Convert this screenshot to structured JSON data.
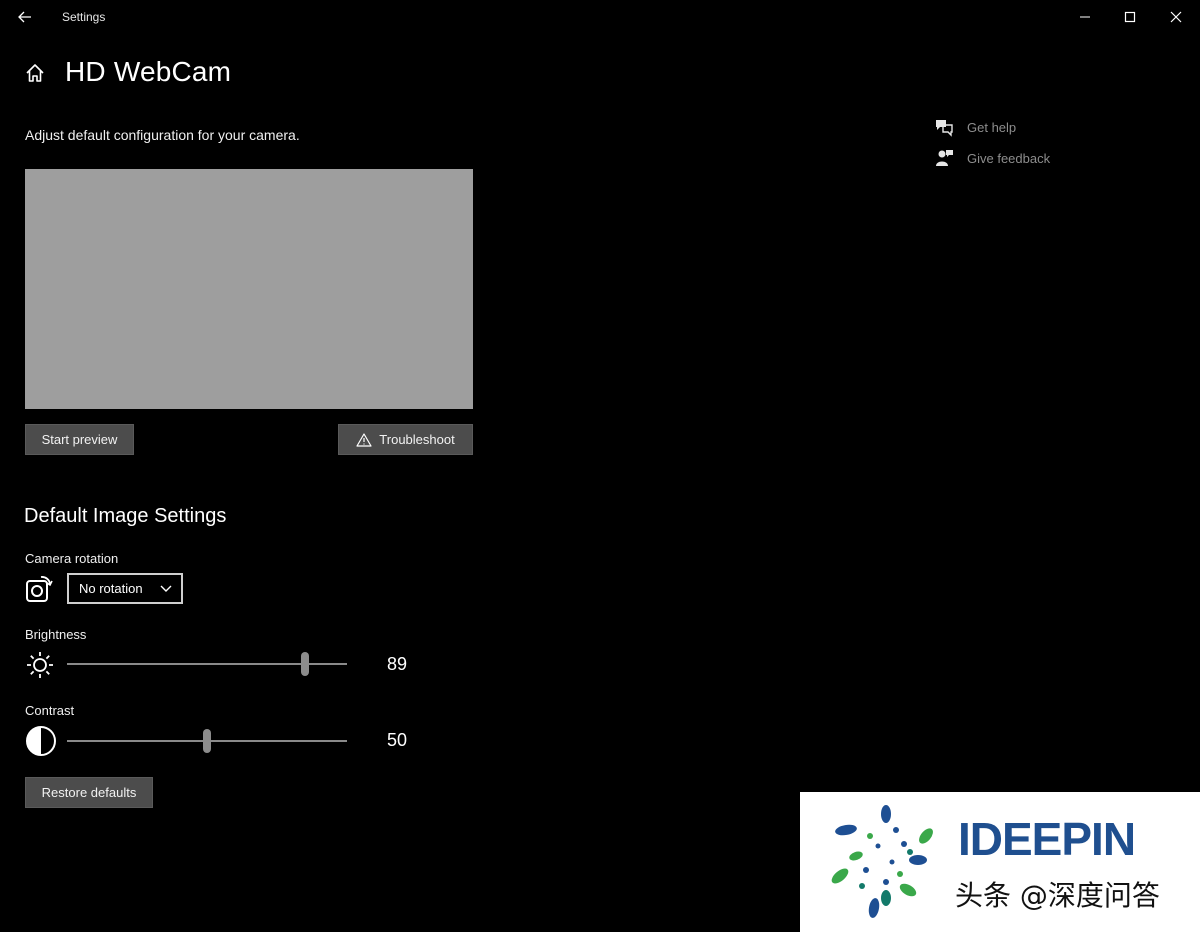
{
  "titlebar": {
    "title": "Settings",
    "icons": [
      "back-arrow-icon",
      "minimize-icon",
      "maximize-icon",
      "close-icon"
    ]
  },
  "header": {
    "title": "HD WebCam",
    "description": "Adjust default configuration for your camera."
  },
  "preview": {
    "start_label": "Start preview",
    "troubleshoot_label": "Troubleshoot"
  },
  "image_settings": {
    "title": "Default Image Settings",
    "rotation": {
      "label": "Camera rotation",
      "selected": "No rotation"
    },
    "brightness": {
      "label": "Brightness",
      "value": 89,
      "min": 0,
      "max": 100
    },
    "contrast": {
      "label": "Contrast",
      "value": 50,
      "min": 0,
      "max": 100
    },
    "restore_label": "Restore defaults"
  },
  "help": {
    "get_help": "Get help",
    "give_feedback": "Give feedback"
  },
  "watermark": {
    "brand": "IDEEPIN",
    "text": "头条 @深度问答"
  },
  "colors": {
    "background": "#000000",
    "preview": "#9e9e9e",
    "button": "#4c4c4c",
    "link": "#8d8d8d",
    "brand": "#1f4f8f"
  }
}
